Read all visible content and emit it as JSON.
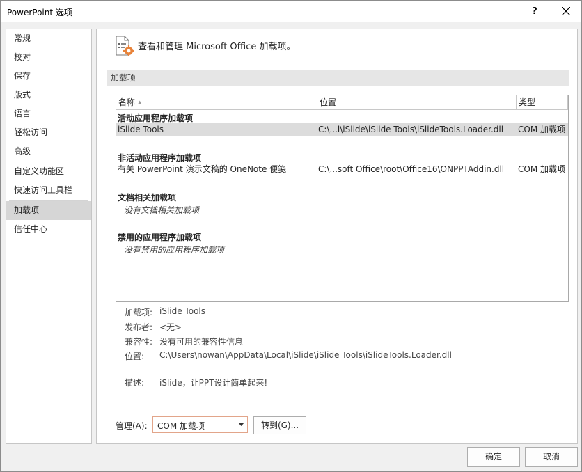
{
  "window": {
    "title": "PowerPoint 选项",
    "help": "?"
  },
  "sidebar": {
    "items": [
      {
        "label": "常规"
      },
      {
        "label": "校对"
      },
      {
        "label": "保存"
      },
      {
        "label": "版式"
      },
      {
        "label": "语言"
      },
      {
        "label": "轻松访问"
      },
      {
        "label": "高级"
      },
      {
        "label": "自定义功能区"
      },
      {
        "label": "快速访问工具栏"
      },
      {
        "label": "加载项"
      },
      {
        "label": "信任中心"
      }
    ],
    "active": "加载项"
  },
  "main": {
    "header": "查看和管理 Microsoft Office 加载项。",
    "section_title": "加载项",
    "columns": [
      "名称",
      "位置",
      "类型"
    ],
    "groups": [
      {
        "title": "活动应用程序加载项",
        "rows": [
          {
            "name": "iSlide Tools",
            "location": "C:\\...l\\iSlide\\iSlide Tools\\iSlideTools.Loader.dll",
            "type": "COM 加载项"
          }
        ]
      },
      {
        "title": "非活动应用程序加载项",
        "rows": [
          {
            "name": "有关 PowerPoint 演示文稿的 OneNote 便笺",
            "location": "C:\\...soft Office\\root\\Office16\\ONPPTAddin.dll",
            "type": "COM 加载项"
          }
        ]
      },
      {
        "title": "文档相关加载项",
        "empty": "没有文档相关加载项"
      },
      {
        "title": "禁用的应用程序加载项",
        "empty": "没有禁用的应用程序加载项"
      }
    ],
    "details": {
      "addin_label": "加载项:",
      "addin": "iSlide Tools",
      "publisher_label": "发布者:",
      "publisher": "<无>",
      "compat_label": "兼容性:",
      "compat": "没有可用的兼容性信息",
      "location_label": "位置:",
      "location": "C:\\Users\\nowan\\AppData\\Local\\iSlide\\iSlide Tools\\iSlideTools.Loader.dll",
      "desc_label": "描述:",
      "desc": "iSlide，让PPT设计简单起来!"
    },
    "manage_label": "管理(A):",
    "manage_value": "COM 加载项",
    "goto_label": "转到(G)..."
  },
  "buttons": {
    "ok": "确定",
    "cancel": "取消"
  },
  "colors": {
    "accent_border": "#e2a58a",
    "accent_icon": "#e8833a",
    "selected_nav": "#d6d6d6"
  }
}
